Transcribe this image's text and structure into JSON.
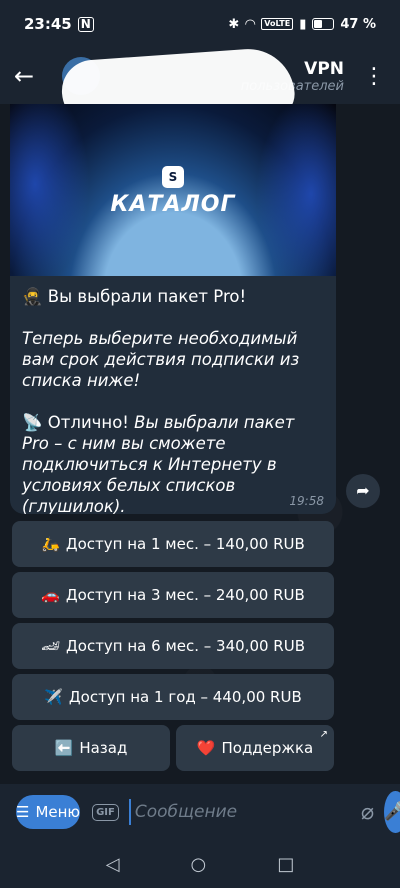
{
  "status_bar": {
    "time": "23:45",
    "nfc": "N",
    "volte": "VoLTE",
    "battery": "47 %"
  },
  "header": {
    "title": "VPN",
    "subtitle": "пользователей"
  },
  "message": {
    "banner_title": "КАТАЛОГ",
    "banner_logo": "S",
    "line1_emoji": "🥷",
    "line1": "Вы выбрали пакет Pro!",
    "line2": "Теперь выберите необходимый вам срок действия подписки из списка ниже!",
    "line3_emoji": "📡",
    "line3_bold": "Отлично!",
    "line3_rest": " Вы выбрали пакет Pro – с ним вы сможете подключиться к Интернету в условиях белых списков (глушилок).",
    "time": "19:58"
  },
  "buttons": {
    "b1": {
      "emoji": "🛵",
      "label": "Доступ на 1 мес. – 140,00 RUB"
    },
    "b2": {
      "emoji": "🚗",
      "label": "Доступ на 3 мес. – 240,00 RUB"
    },
    "b3": {
      "emoji": "🏎",
      "label": "Доступ на 6 мес. – 340,00 RUB"
    },
    "b4": {
      "emoji": "✈️",
      "label": "Доступ на 1 год – 440,00 RUB"
    },
    "back": {
      "emoji": "⬅️",
      "label": "Назад"
    },
    "support": {
      "emoji": "❤️",
      "label": "Поддержка"
    }
  },
  "input": {
    "menu_label": "Меню",
    "gif": "GIF",
    "placeholder": "Сообщение"
  },
  "colors": {
    "accent": "#3a7fd5",
    "bubble": "#212d3b",
    "button": "#2e3a47"
  }
}
